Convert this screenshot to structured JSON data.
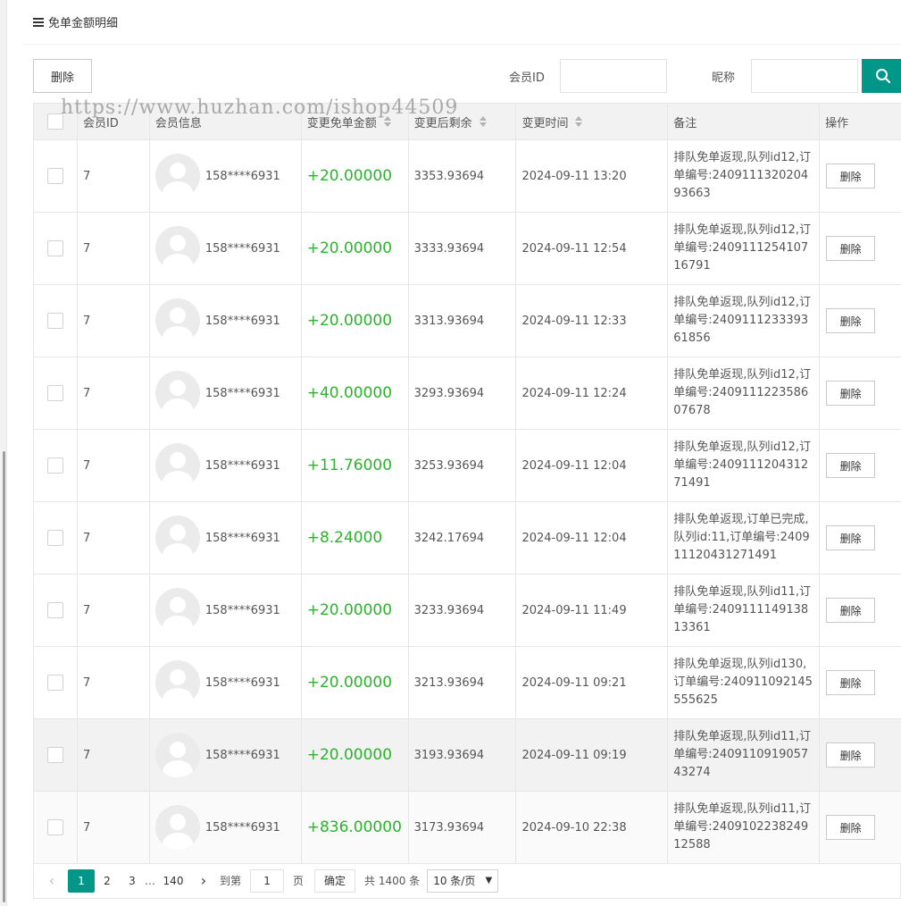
{
  "header": {
    "title": "免单金额明细"
  },
  "toolbar": {
    "delete_label": "删除",
    "member_id_label": "会员ID",
    "member_id_value": "",
    "nickname_label": "昵称",
    "nickname_value": ""
  },
  "watermark": "https://www.huzhan.com/ishop44509",
  "table": {
    "columns": [
      "会员ID",
      "会员信息",
      "变更免单金额",
      "变更后剩余",
      "变更时间",
      "备注",
      "操作"
    ],
    "rows": [
      {
        "member_id": "7",
        "phone": "158****6931",
        "amount": "+20.00000",
        "remaining": "3353.93694",
        "time": "2024-09-11 13:20",
        "remark": "排队免单返现,队列id12,订单编号:240911132020493663",
        "action": "删除"
      },
      {
        "member_id": "7",
        "phone": "158****6931",
        "amount": "+20.00000",
        "remaining": "3333.93694",
        "time": "2024-09-11 12:54",
        "remark": "排队免单返现,队列id12,订单编号:240911125410716791",
        "action": "删除"
      },
      {
        "member_id": "7",
        "phone": "158****6931",
        "amount": "+20.00000",
        "remaining": "3313.93694",
        "time": "2024-09-11 12:33",
        "remark": "排队免单返现,队列id12,订单编号:240911123339361856",
        "action": "删除"
      },
      {
        "member_id": "7",
        "phone": "158****6931",
        "amount": "+40.00000",
        "remaining": "3293.93694",
        "time": "2024-09-11 12:24",
        "remark": "排队免单返现,队列id12,订单编号:240911122358607678",
        "action": "删除"
      },
      {
        "member_id": "7",
        "phone": "158****6931",
        "amount": "+11.76000",
        "remaining": "3253.93694",
        "time": "2024-09-11 12:04",
        "remark": "排队免单返现,队列id12,订单编号:240911120431271491",
        "action": "删除"
      },
      {
        "member_id": "7",
        "phone": "158****6931",
        "amount": "+8.24000",
        "remaining": "3242.17694",
        "time": "2024-09-11 12:04",
        "remark": "排队免单返现,订单已完成,队列id:11,订单编号:240911120431271491",
        "action": "删除"
      },
      {
        "member_id": "7",
        "phone": "158****6931",
        "amount": "+20.00000",
        "remaining": "3233.93694",
        "time": "2024-09-11 11:49",
        "remark": "排队免单返现,队列id11,订单编号:240911114913813361",
        "action": "删除"
      },
      {
        "member_id": "7",
        "phone": "158****6931",
        "amount": "+20.00000",
        "remaining": "3213.93694",
        "time": "2024-09-11 09:21",
        "remark": "排队免单返现,队列id130,订单编号:240911092145555625",
        "action": "删除"
      },
      {
        "member_id": "7",
        "phone": "158****6931",
        "amount": "+20.00000",
        "remaining": "3193.93694",
        "time": "2024-09-11 09:19",
        "remark": "排队免单返现,队列id11,订单编号:240911091905743274",
        "action": "删除"
      },
      {
        "member_id": "7",
        "phone": "158****6931",
        "amount": "+836.00000",
        "remaining": "3173.93694",
        "time": "2024-09-10 22:38",
        "remark": "排队免单返现,队列id11,订单编号:240910223824912588",
        "action": "删除"
      }
    ]
  },
  "pagination": {
    "pages": [
      "1",
      "2",
      "3"
    ],
    "ellipsis": "…",
    "last_page": "140",
    "goto_label": "到第",
    "goto_value": "1",
    "page_unit": "页",
    "confirm_label": "确定",
    "total_label": "共 1400 条",
    "page_size": "10 条/页"
  },
  "colors": {
    "accent": "#009688",
    "amount_positive": "#2cb32c"
  }
}
